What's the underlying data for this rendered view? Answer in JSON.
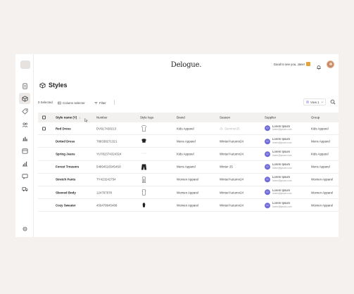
{
  "app": {
    "brand": "Delogue.",
    "greeting": "Good to see you, Jane!"
  },
  "sidebar": {
    "items": [
      {
        "icon": "document-icon",
        "active": false
      },
      {
        "icon": "cube-icon",
        "active": true
      },
      {
        "icon": "tag-icon",
        "active": false
      },
      {
        "icon": "people-icon",
        "active": false
      },
      {
        "icon": "bar-chart-icon",
        "active": false
      },
      {
        "icon": "calendar-icon",
        "active": false
      },
      {
        "icon": "analytics-icon",
        "active": false
      },
      {
        "icon": "message-icon",
        "active": false
      },
      {
        "icon": "truck-icon",
        "active": false
      }
    ],
    "settings_icon": "gear-icon"
  },
  "page": {
    "title": "Styles"
  },
  "toolbar": {
    "selected": "0 Selected",
    "column_selector": "Column selector",
    "filter": "Filter",
    "view": "View 1"
  },
  "table": {
    "headers": {
      "name": "Style name (Y)",
      "number": "Number",
      "logo": "Style logo",
      "brand": "Brand",
      "season": "Season",
      "supplier": "Supplier",
      "group": "Group"
    },
    "rows": [
      {
        "name": "Red Dress",
        "number": "DV917428213",
        "logo": "shirt",
        "brand": "Kids Apparel",
        "season": "Summer25",
        "season_faded": true,
        "supplier": "Lorem Ipsum",
        "supplier_email": "lorem@ipsum.com",
        "group": "Kids Apparel"
      },
      {
        "name": "Dotted Dress",
        "number": "789338271321",
        "logo": "tshirt",
        "brand": "Mens Apparel",
        "season": "Winter/Autumn24",
        "season_faded": false,
        "supplier": "Lorem Ipsum",
        "supplier_email": "lorem@ipsum.com",
        "group": "Mens Apparel"
      },
      {
        "name": "Spring Jeans",
        "number": "YU782374324324",
        "logo": "blank",
        "brand": "Kids Apparel",
        "season": "Winter/Autumn24",
        "season_faded": false,
        "supplier": "Lorem Ipsum",
        "supplier_email": "lorem@ipsum.com",
        "group": "Kids Apparel"
      },
      {
        "name": "Forest Trousers",
        "number": "548945165454S8",
        "logo": "trousers",
        "brand": "Mens Apparel",
        "season": "Winter 25",
        "season_faded": false,
        "supplier": "Lorem Ipsum",
        "supplier_email": "lorem@ipsum.com",
        "group": "Mens Apparel"
      },
      {
        "name": "Stretch Pants",
        "number": "TY423242754",
        "logo": "pants",
        "brand": "Women Apparel",
        "season": "Winter/Autumn24",
        "season_faded": false,
        "supplier": "Lorem Ipsum",
        "supplier_email": "lorem@ipsum.com",
        "group": "Women Apparel"
      },
      {
        "name": "Sleeved Body",
        "number": "124787878",
        "logo": "body",
        "brand": "Women Apparel",
        "season": "Winter/Autumn24",
        "season_faded": false,
        "supplier": "Lorem Ipsum",
        "supplier_email": "lorem@ipsum.com",
        "group": "Women Apparel"
      },
      {
        "name": "Cozy Sweater",
        "number": "456478945488",
        "logo": "sweater",
        "brand": "Women Apparel",
        "season": "Winter/Autumn24",
        "season_faded": false,
        "supplier": "Lorem Ipsum",
        "supplier_email": "lorem@ipsum.com",
        "group": "Women Apparel"
      }
    ]
  },
  "colors": {
    "background": "#f4f1ef",
    "accent": "#6f6bd8",
    "header_row": "#f3f1f0",
    "view_swatch": "#c8c6f0"
  }
}
